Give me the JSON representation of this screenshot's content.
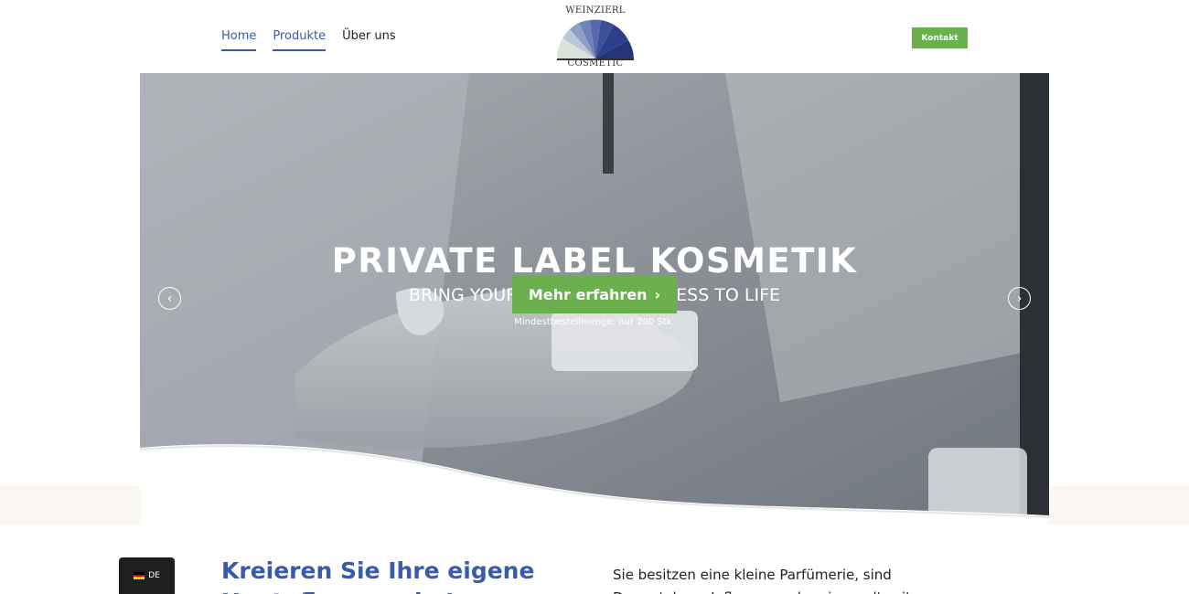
{
  "nav": {
    "items": [
      {
        "label": "Home",
        "active": true
      },
      {
        "label": "Produkte",
        "active": true
      },
      {
        "label": "Über uns",
        "active": false
      }
    ]
  },
  "logo": {
    "top_text": "WEINZIERL",
    "bottom_text": "COSMETIC"
  },
  "header": {
    "contact_label": "Kontakt"
  },
  "hero": {
    "title": "PRIVATE LABEL KOSMETIK",
    "subtitle": "BRING YOUR SKIN CARE BUSINESS TO LIFE",
    "note": "Mindestbestellmenge: nur 200 Stk.",
    "cta_label": "Mehr erfahren",
    "cta_icon": "chevron-right-icon",
    "prev_icon": "chevron-left-icon",
    "next_icon": "chevron-right-icon"
  },
  "language": {
    "code": "DE",
    "flag_colors": [
      "#000000",
      "#dd0000",
      "#ffce00"
    ]
  },
  "content": {
    "headline": "Kreieren Sie Ihre eigene Hautpflegemarke!",
    "intro": "Sie besitzen eine kleine Parfümerie, sind Dermatologe, Influencer oder eine weltweite"
  },
  "colors": {
    "accent": "#3b5aa8",
    "green": "#6ab04c",
    "band": "#faf6f1"
  }
}
